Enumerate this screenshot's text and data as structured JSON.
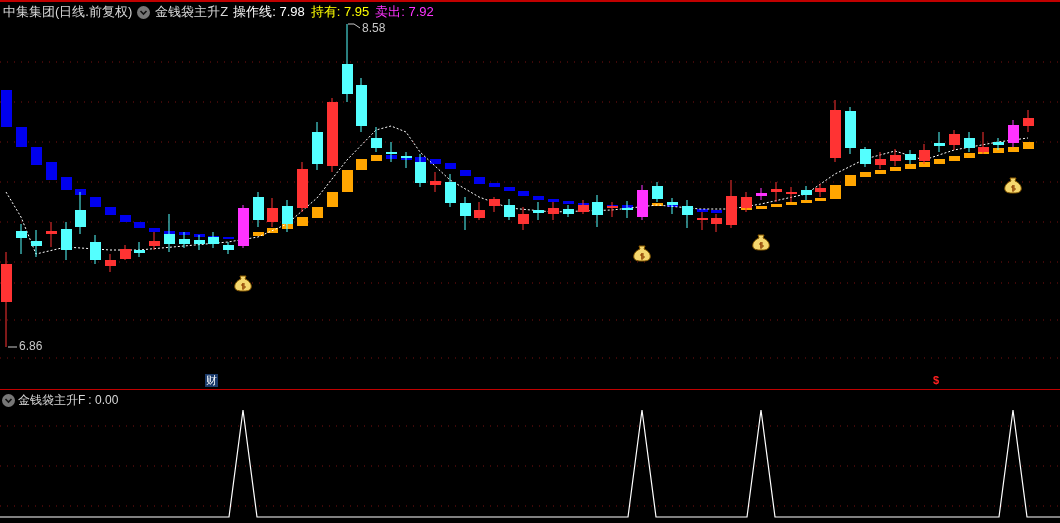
{
  "header": {
    "title": "中集集团(日线.前复权)",
    "indicator": "金钱袋主升Z",
    "lines": [
      {
        "label": "操作线: 7.98",
        "kind": "operation"
      },
      {
        "label": "持有: 7.95",
        "kind": "hold"
      },
      {
        "label": "卖出: 7.92",
        "kind": "sell"
      }
    ]
  },
  "price_chart": {
    "high_label": "8.58",
    "low_label": "6.86"
  },
  "event_markers": [
    {
      "text": "财",
      "kind": "finance"
    },
    {
      "text": "$",
      "kind": "dividend"
    }
  ],
  "sub_panel": {
    "indicator": "金钱袋主升F",
    "reading": ": 0.00"
  }
}
